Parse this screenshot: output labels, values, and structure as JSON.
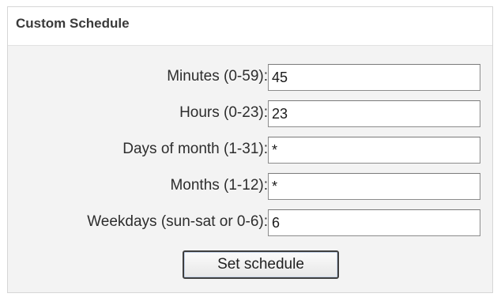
{
  "panel": {
    "title": "Custom Schedule"
  },
  "fields": {
    "minutes": {
      "label": "Minutes (0-59):",
      "value": "45"
    },
    "hours": {
      "label": "Hours (0-23):",
      "value": "23"
    },
    "days_of_month": {
      "label": "Days of month (1-31):",
      "value": "*"
    },
    "months": {
      "label": "Months (1-12):",
      "value": "*"
    },
    "weekdays": {
      "label": "Weekdays (sun-sat or 0-6):",
      "value": "6"
    }
  },
  "actions": {
    "set_schedule_label": "Set schedule"
  }
}
